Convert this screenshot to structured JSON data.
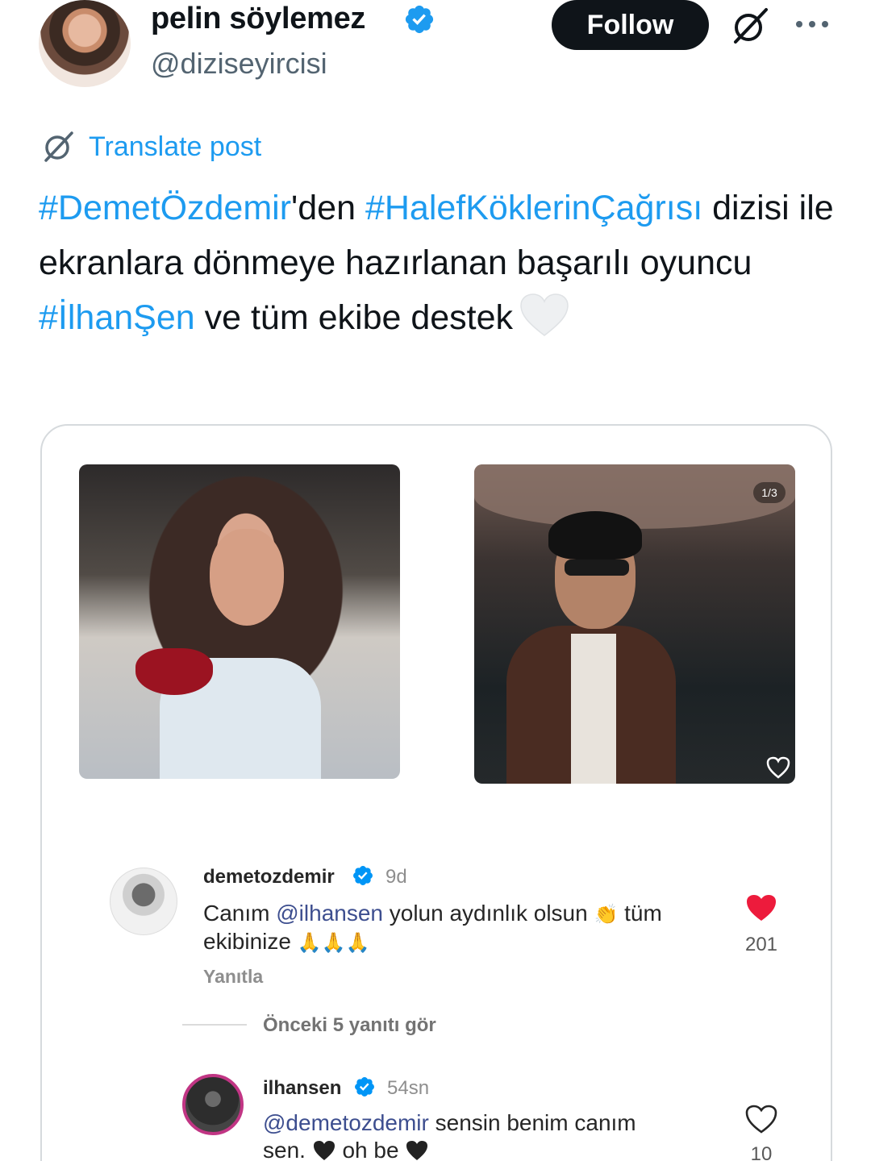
{
  "author": {
    "name": "pelin söylemez",
    "handle": "@diziseyircisi",
    "follow_label": "Follow"
  },
  "translate_label": "Translate post",
  "post": {
    "tag1": "#DemetÖzdemir",
    "text1": "'den ",
    "tag2": "#HalefKöklerinÇağrısı",
    "text2": " dizisi ile ekranlara dönmeye hazırlanan başarılı oyuncu ",
    "tag3": "#İlhanŞen",
    "text3": " ve tüm ekibe destek"
  },
  "media": {
    "counter": "1/3"
  },
  "comments": [
    {
      "username": "demetozdemir",
      "time": "9d",
      "text_before": "Canım ",
      "mention": "@ilhansen",
      "text_after": " yolun aydınlık olsun",
      "emoji_clap": "👏",
      "text_after2": " tüm ekibinize ",
      "emoji_pray": "🙏🙏🙏",
      "reply_label": "Yanıtla",
      "likes": "201"
    },
    {
      "username": "ilhansen",
      "time": "54sn",
      "mention": "@demetozdemir",
      "text_line1": " sensin benim canım",
      "text_line2a": "sen. ",
      "text_line2b": " oh be ",
      "likes": "10"
    }
  ],
  "view_replies_label": "Önceki 5 yanıtı gör",
  "colors": {
    "accent": "#1d9bf0",
    "mention": "#3d4e8f",
    "like_red": "#ed1b3c"
  }
}
